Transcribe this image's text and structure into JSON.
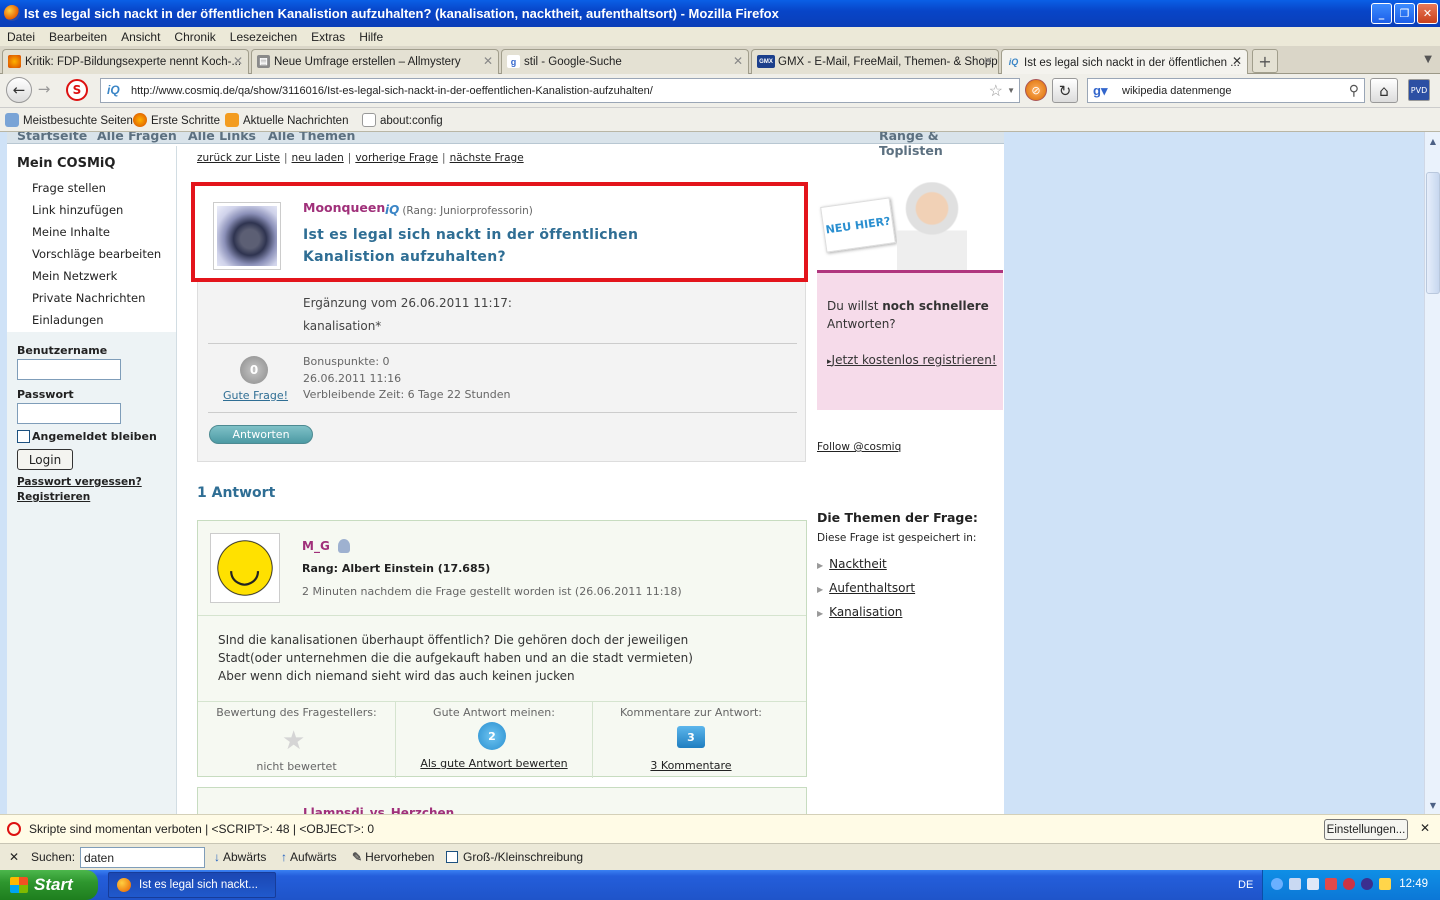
{
  "window": {
    "title": "Ist es legal sich nackt in der öffentlichen Kanalistion aufzuhalten? (kanalisation, nacktheit, aufenthaltsort) - Mozilla Firefox",
    "min": "_",
    "max": "❐",
    "close": "✕"
  },
  "menubar": [
    "Datei",
    "Bearbeiten",
    "Ansicht",
    "Chronik",
    "Lesezeichen",
    "Extras",
    "Hilfe"
  ],
  "tabs": [
    {
      "label": "Kritik: FDP-Bildungsexperte nennt Koch-...",
      "icon": "firefox-icon"
    },
    {
      "label": "Neue Umfrage erstellen – Allmystery",
      "icon": "page-icon"
    },
    {
      "label": "stil - Google-Suche",
      "icon": "google-icon"
    },
    {
      "label": "GMX - E-Mail, FreeMail, Themen- & Shopp...",
      "icon": "gmx-icon"
    },
    {
      "label": "Ist es legal sich nackt in der öffentlichen ...",
      "icon": "cosmiq-icon",
      "active": true
    }
  ],
  "navbar": {
    "url": "http://www.cosmiq.de/qa/show/3116016/Ist-es-legal-sich-nackt-in-der-oeffentlichen-Kanalistion-aufzuhalten/",
    "site_icon": "iQ",
    "search": "wikipedia datenmenge"
  },
  "bookmarks": [
    "Meistbesuchte Seiten",
    "Erste Schritte",
    "Aktuelle Nachrichten",
    "about:config"
  ],
  "sitenav": {
    "items": [
      "Startseite",
      "Alle Fragen",
      "Alle Links",
      "Alle Themen"
    ],
    "right": "Range & Toplisten"
  },
  "sidebar": {
    "title": "Mein COSMiQ",
    "items": [
      "Frage stellen",
      "Link hinzufügen",
      "Meine Inhalte",
      "Vorschläge bearbeiten",
      "Mein Netzwerk",
      "Private Nachrichten",
      "Einladungen"
    ],
    "login": {
      "username_label": "Benutzername",
      "password_label": "Passwort",
      "remember_label": "Angemeldet bleiben",
      "login_button": "Login",
      "forgot": "Passwort vergessen?",
      "register": "Registrieren"
    }
  },
  "subnav": [
    "zurück zur Liste",
    "neu laden",
    "vorherige Frage",
    "nächste Frage"
  ],
  "question": {
    "author": "Moonqueen",
    "iq": "iQ",
    "rank": "(Rang: Juniorprofessorin)",
    "title": "Ist es legal sich nackt in der öffentlichen Kanalistion aufzuhalten?",
    "addition_header": "Ergänzung vom 26.06.2011 11:17:",
    "addition_text": "kanalisation*",
    "score": "0",
    "good_question": "Gute Frage!",
    "bonus": "Bonuspunkte: 0",
    "date": "26.06.2011 11:16",
    "remaining": "Verbleibende Zeit: 6 Tage 22 Stunden",
    "answer_button": "Antworten"
  },
  "answers_count": "1 Antwort",
  "answer": {
    "author": "M_G",
    "rank": "Rang: Albert Einstein (17.685)",
    "time": "2 Minuten nachdem die Frage gestellt worden ist (26.06.2011 11:18)",
    "lines": [
      "SInd die kanalisationen überhaupt öffentlich? Die gehören doch der jeweiligen",
      "Stadt(oder unternehmen die die aufgekauft haben und an die stadt vermieten)",
      "Aber wenn dich niemand sieht wird das auch keinen jucken"
    ],
    "col1_header": "Bewertung des Fragestellers:",
    "col1_value": "nicht bewertet",
    "col2_header": "Gute Antwort meinen:",
    "col2_count": "2",
    "col2_link": "Als gute Antwort bewerten",
    "col3_header": "Kommentare zur Antwort:",
    "col3_count": "3",
    "col3_link": "3 Kommentare"
  },
  "next_answer_author": "Llampsdi_vs_Herzchen",
  "right": {
    "neu_hier": "NEU HIER?",
    "promo_text_1": "Du willst ",
    "promo_text_bold": "noch schnellere",
    "promo_text_2": " Antworten?",
    "promo_link": "Jetzt kostenlos registrieren!",
    "follow": "Follow @cosmiq",
    "themes_header": "Die Themen der Frage:",
    "themes_sub": "Diese Frage ist gespeichert in:",
    "themes": [
      "Nacktheit",
      "Aufenthaltsort",
      "Kanalisation"
    ]
  },
  "noscript": {
    "text": "Skripte sind momentan verboten | <SCRIPT>: 48 | <OBJECT>: 0",
    "button": "Einstellungen..."
  },
  "findbar": {
    "label": "Suchen:",
    "value": "daten",
    "down": "Abwärts",
    "up": "Aufwärts",
    "highlight": "Hervorheben",
    "case": "Groß-/Kleinschreibung"
  },
  "taskbar": {
    "start": "Start",
    "item": "Ist es legal sich nackt...",
    "lang": "DE",
    "clock": "12:49"
  },
  "colors": {
    "accent_red": "#e3141b",
    "author": "#a0307a",
    "title_blue": "#2f6e94"
  }
}
